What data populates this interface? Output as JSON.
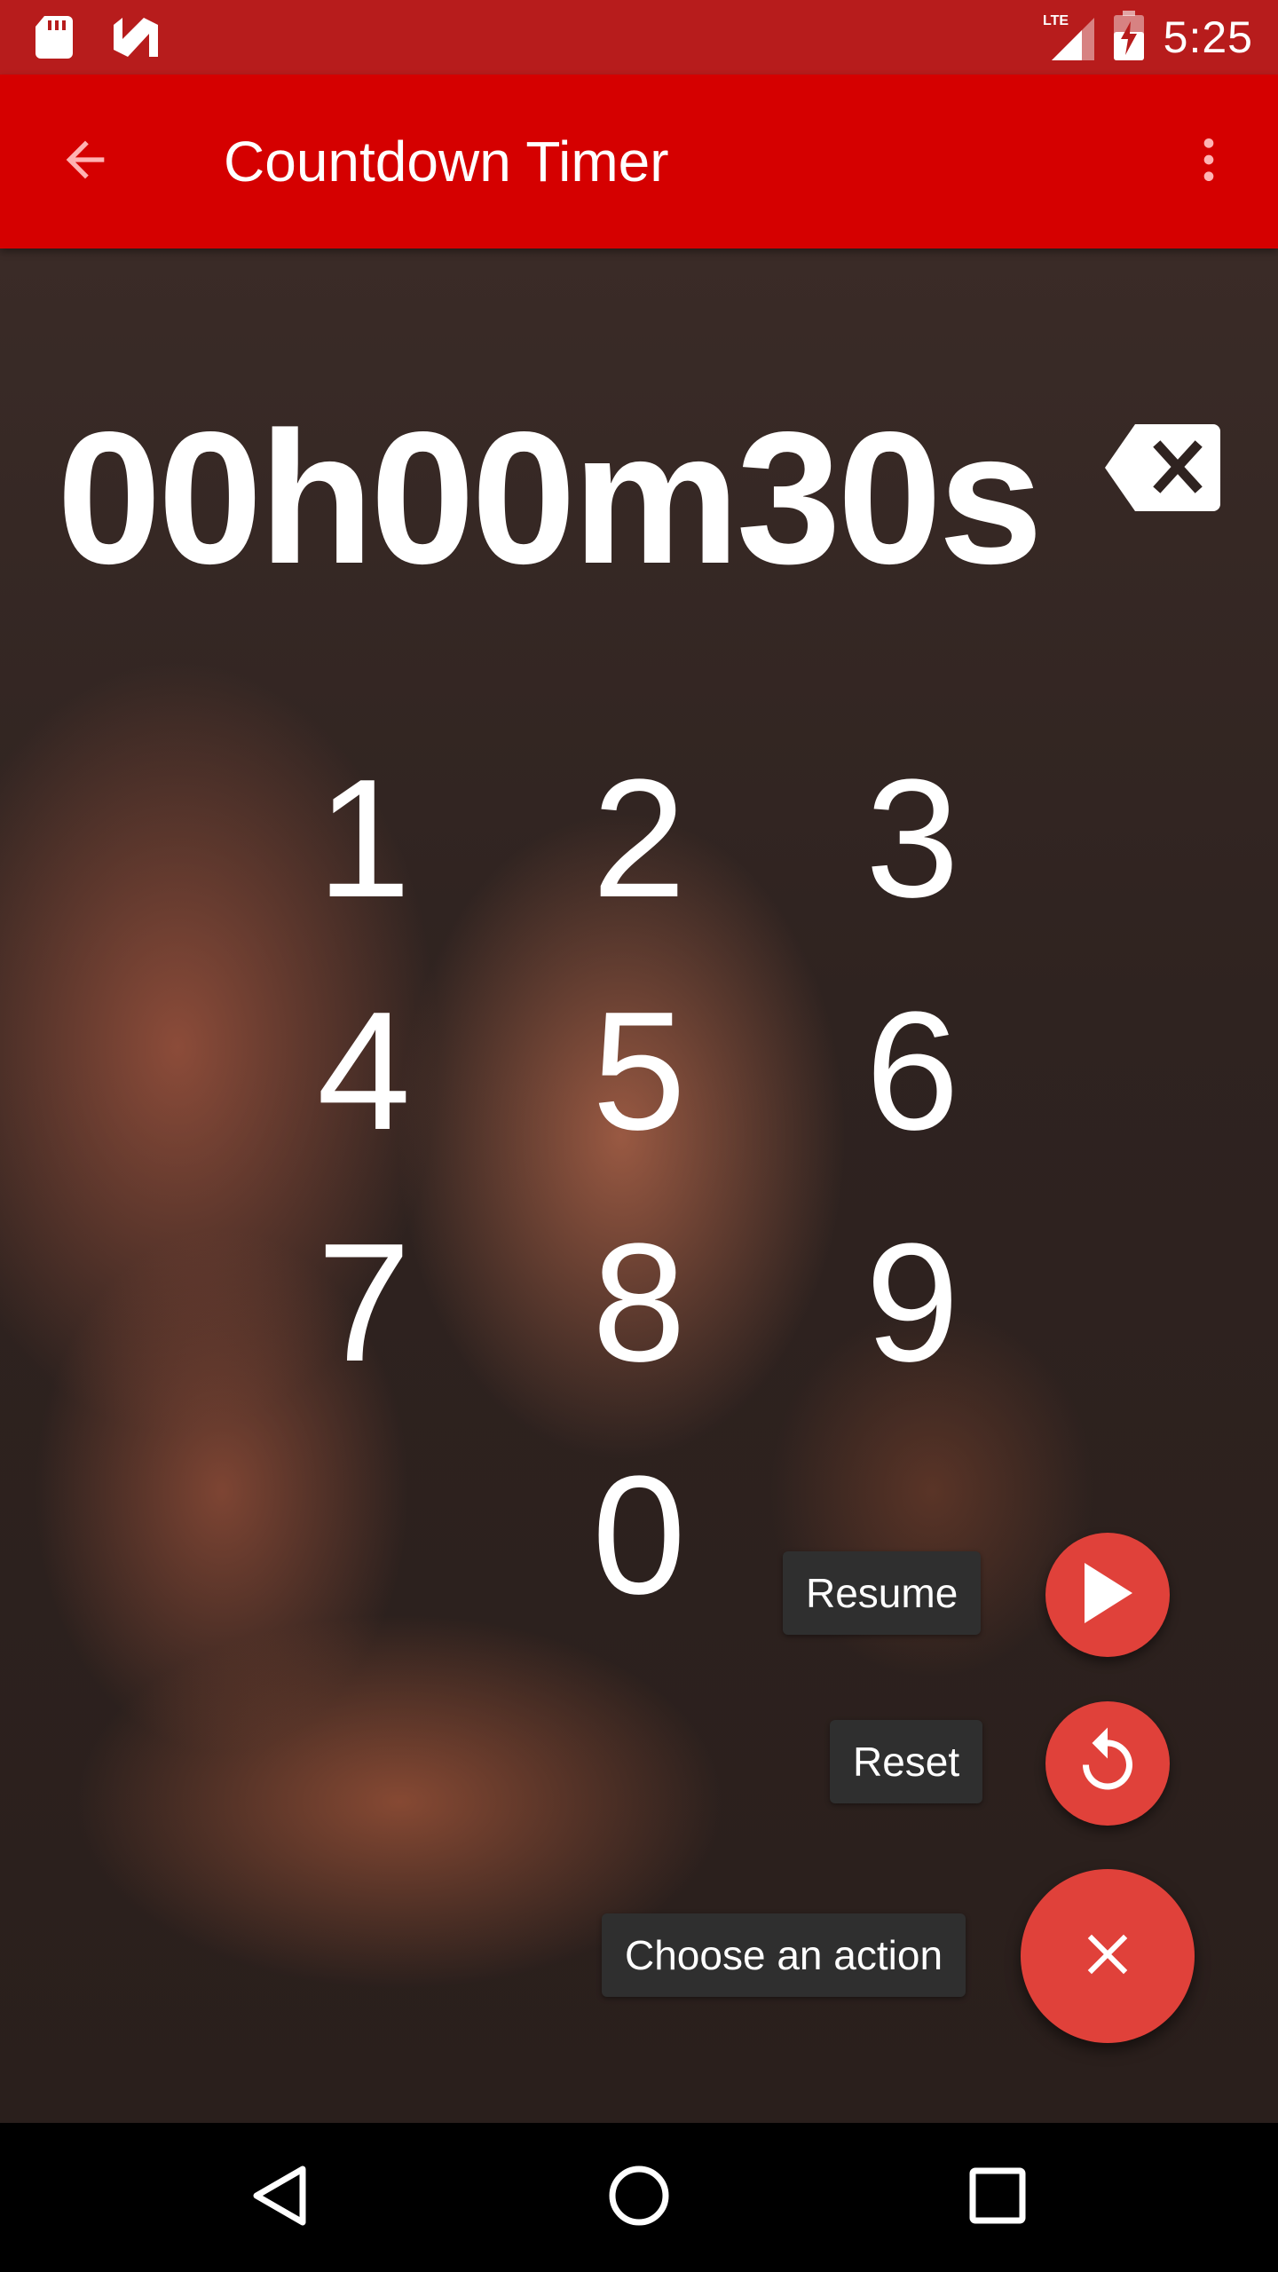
{
  "status_bar": {
    "time": "5:25",
    "icons": [
      "sd-card-icon",
      "app-n-icon",
      "lte-signal-icon",
      "battery-charging-icon"
    ],
    "network_label": "LTE"
  },
  "app_bar": {
    "title": "Countdown Timer",
    "back_icon": "arrow-back-icon",
    "menu_icon": "more-vert-icon",
    "color": "#d50000"
  },
  "timer": {
    "display": "00h00m30s"
  },
  "keypad": {
    "keys": [
      "1",
      "2",
      "3",
      "4",
      "5",
      "6",
      "7",
      "8",
      "9",
      "0"
    ]
  },
  "fab_menu": {
    "resume_label": "Resume",
    "reset_label": "Reset",
    "main_label": "Choose an action",
    "accent": "#e0413a"
  },
  "nav_bar": {
    "buttons": [
      "back-triangle-icon",
      "home-circle-icon",
      "recents-square-icon"
    ]
  }
}
